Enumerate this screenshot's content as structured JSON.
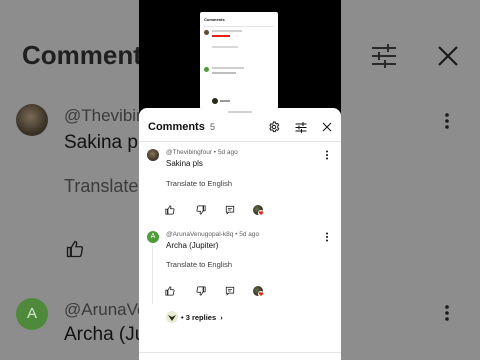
{
  "background": {
    "title": "Comments",
    "comment1": {
      "handle": "@Thevibin",
      "text": "Sakina pl",
      "translate": "Translate"
    },
    "comment2": {
      "avatar_letter": "A",
      "handle": "@ArunaVe",
      "text": "Archa (Ju"
    }
  },
  "panel": {
    "title": "Comments",
    "count": "5",
    "icons": [
      "gear-icon",
      "filter-icon",
      "close-icon"
    ]
  },
  "comments": [
    {
      "handle": "@Thevibingfour",
      "time": "5d ago",
      "meta": "@Thevibingfour • 5d ago",
      "text": "Sakina pls",
      "translate": "Translate to English"
    },
    {
      "avatar_letter": "A",
      "handle": "@ArunaVenugopal-k8q",
      "time": "5d ago",
      "meta": "@ArunaVenugopal-k8q • 5d ago",
      "text": "Archa (Jupiter)",
      "translate": "Translate to English",
      "replies": "• 3 replies",
      "replies_chevron": "›"
    }
  ],
  "colors": {
    "creator_heart": "#e62117",
    "avatar_green": "#4f9a3a",
    "background_dim": "#8d8d8d"
  }
}
